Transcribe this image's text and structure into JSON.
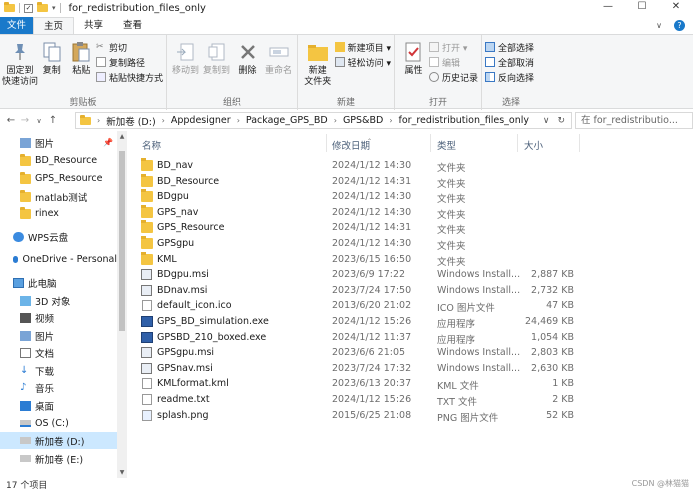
{
  "window": {
    "title": "for_redistribution_files_only",
    "controls": [
      "—",
      "☐",
      "✕"
    ]
  },
  "ribbon_tabs": [
    "文件",
    "主页",
    "共享",
    "查看"
  ],
  "ribbon": {
    "clipboard": {
      "name": "剪贴板",
      "pin": "固定到\n快速访问",
      "copy": "复制",
      "paste": "粘贴",
      "cut": "剪切",
      "copy_path": "复制路径",
      "paste_shortcut": "粘贴快捷方式"
    },
    "organize": {
      "name": "组织",
      "move_to": "移动到",
      "copy_to": "复制到",
      "delete": "删除",
      "rename": "重命名"
    },
    "new": {
      "name": "新建",
      "new_folder": "新建\n文件夹",
      "new_item": "新建项目 ▾",
      "easy_access": "轻松访问 ▾"
    },
    "open": {
      "name": "打开",
      "properties": "属性",
      "open": "打开 ▾",
      "edit": "编辑",
      "history": "历史记录"
    },
    "select": {
      "name": "选择",
      "select_all": "全部选择",
      "select_none": "全部取消",
      "invert": "反向选择"
    }
  },
  "address": {
    "crumbs": [
      "新加卷 (D:)",
      "Appdesigner",
      "Package_GPS_BD",
      "GPS&BD",
      "for_redistribution_files_only"
    ],
    "search_placeholder": "在 for_redistributio..."
  },
  "nav": {
    "items": [
      {
        "label": "图片",
        "icon": "pictures-icon",
        "pinned": true
      },
      {
        "label": "BD_Resource",
        "icon": "folder-icon"
      },
      {
        "label": "GPS_Resource",
        "icon": "folder-icon"
      },
      {
        "label": "matlab测试",
        "icon": "folder-icon"
      },
      {
        "label": "rinex",
        "icon": "folder-icon"
      },
      {
        "label": "WPS云盘",
        "icon": "cloud-icon"
      },
      {
        "label": "OneDrive - Personal",
        "icon": "onedrive-icon"
      },
      {
        "label": "此电脑",
        "icon": "computer-icon"
      },
      {
        "label": "3D 对象",
        "icon": "cube-icon"
      },
      {
        "label": "视频",
        "icon": "video-icon"
      },
      {
        "label": "图片",
        "icon": "pictures-icon"
      },
      {
        "label": "文档",
        "icon": "document-icon"
      },
      {
        "label": "下载",
        "icon": "download-icon"
      },
      {
        "label": "音乐",
        "icon": "music-icon"
      },
      {
        "label": "桌面",
        "icon": "desktop-icon"
      },
      {
        "label": "OS (C:)",
        "icon": "drive-icon"
      },
      {
        "label": "新加卷 (D:)",
        "icon": "drive-icon",
        "selected": true
      },
      {
        "label": "新加卷 (E:)",
        "icon": "drive-icon"
      }
    ]
  },
  "columns": {
    "name": "名称",
    "date": "修改日期",
    "type": "类型",
    "size": "大小"
  },
  "files": [
    {
      "name": "BD_nav",
      "date": "2024/1/12 14:30",
      "type": "文件夹",
      "size": "",
      "icon": "folder"
    },
    {
      "name": "BD_Resource",
      "date": "2024/1/12 14:31",
      "type": "文件夹",
      "size": "",
      "icon": "folder"
    },
    {
      "name": "BDgpu",
      "date": "2024/1/12 14:30",
      "type": "文件夹",
      "size": "",
      "icon": "folder"
    },
    {
      "name": "GPS_nav",
      "date": "2024/1/12 14:30",
      "type": "文件夹",
      "size": "",
      "icon": "folder"
    },
    {
      "name": "GPS_Resource",
      "date": "2024/1/12 14:31",
      "type": "文件夹",
      "size": "",
      "icon": "folder"
    },
    {
      "name": "GPSgpu",
      "date": "2024/1/12 14:30",
      "type": "文件夹",
      "size": "",
      "icon": "folder"
    },
    {
      "name": "KML",
      "date": "2023/6/15 16:50",
      "type": "文件夹",
      "size": "",
      "icon": "folder"
    },
    {
      "name": "BDgpu.msi",
      "date": "2023/6/9 17:22",
      "type": "Windows Install...",
      "size": "2,887 KB",
      "icon": "msi"
    },
    {
      "name": "BDnav.msi",
      "date": "2023/7/24 17:50",
      "type": "Windows Install...",
      "size": "2,732 KB",
      "icon": "msi"
    },
    {
      "name": "default_icon.ico",
      "date": "2013/6/20 21:02",
      "type": "ICO 图片文件",
      "size": "47 KB",
      "icon": "doc"
    },
    {
      "name": "GPS_BD_simulation.exe",
      "date": "2024/1/12 15:26",
      "type": "应用程序",
      "size": "24,469 KB",
      "icon": "exe"
    },
    {
      "name": "GPSBD_210_boxed.exe",
      "date": "2024/1/12 11:37",
      "type": "应用程序",
      "size": "1,054 KB",
      "icon": "exe"
    },
    {
      "name": "GPSgpu.msi",
      "date": "2023/6/6 21:05",
      "type": "Windows Install...",
      "size": "2,803 KB",
      "icon": "msi"
    },
    {
      "name": "GPSnav.msi",
      "date": "2023/7/24 17:32",
      "type": "Windows Install...",
      "size": "2,630 KB",
      "icon": "msi"
    },
    {
      "name": "KMLformat.kml",
      "date": "2023/6/13 20:37",
      "type": "KML 文件",
      "size": "1 KB",
      "icon": "doc"
    },
    {
      "name": "readme.txt",
      "date": "2024/1/12 15:26",
      "type": "TXT 文件",
      "size": "2 KB",
      "icon": "doc"
    },
    {
      "name": "splash.png",
      "date": "2015/6/25 21:08",
      "type": "PNG 图片文件",
      "size": "52 KB",
      "icon": "png"
    }
  ],
  "status": {
    "count": "17 个项目",
    "watermark": "CSDN @林猫猫"
  }
}
